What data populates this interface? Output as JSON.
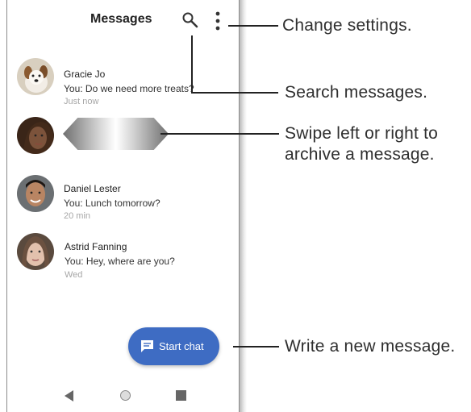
{
  "header": {
    "title": "Messages",
    "search_icon": "search-icon",
    "menu_icon": "more-vert-icon"
  },
  "conversations": [
    {
      "name": "Gracie Jo",
      "preview": "You: Do we need more treats?",
      "time": "Just now",
      "avatar": "dog-avatar"
    },
    {
      "name": "",
      "preview": "",
      "time": "",
      "avatar": "woman-avatar",
      "state": "swiping"
    },
    {
      "name": "Daniel Lester",
      "preview": "You: Lunch tomorrow?",
      "time": "20 min",
      "avatar": "man-avatar"
    },
    {
      "name": "Astrid Fanning",
      "preview": "You: Hey, where are you?",
      "time": "Wed",
      "avatar": "woman-avatar"
    }
  ],
  "fab": {
    "label": "Start chat",
    "icon": "chat-icon",
    "color": "#3e6cc3"
  },
  "navbar": {
    "icons": [
      "back-icon",
      "home-icon",
      "recents-icon"
    ]
  },
  "callouts": {
    "settings": "Change settings.",
    "search": "Search messages.",
    "swipe_line1": "Swipe left or right to",
    "swipe_line2": "archive a message.",
    "new_message": "Write a new message."
  }
}
